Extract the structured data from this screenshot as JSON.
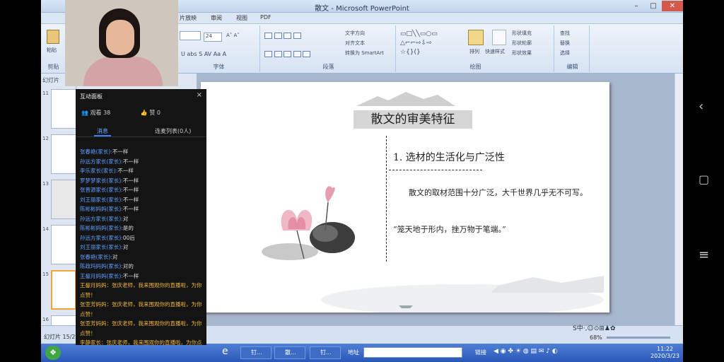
{
  "window": {
    "title": "散文 - Microsoft PowerPoint",
    "minimize": "–",
    "maximize": "□",
    "close": "✕"
  },
  "tabs": [
    "片放映",
    "审阅",
    "视图",
    "PDF"
  ],
  "ribbon": {
    "font": {
      "size": "24",
      "label": "字体"
    },
    "paragraph": {
      "text_direction": "文字方向",
      "align_text": "对齐文本",
      "smartart": "转换为 SmartArt",
      "label": "段落"
    },
    "drawing": {
      "arrange": "排列",
      "quick_styles": "快速样式",
      "fill": "形状填充",
      "outline": "形状轮廓",
      "effects": "形状效果",
      "label": "绘图"
    },
    "editing": {
      "find": "查找",
      "replace": "替换",
      "select": "选择",
      "label": "编辑"
    },
    "clipboard": {
      "paste": "粘贴",
      "label": "剪贴"
    },
    "slides_tab": "幻灯片"
  },
  "thumbnails": [
    "11",
    "12",
    "13",
    "14",
    "15",
    "16"
  ],
  "panel": {
    "title": "互动面板",
    "close": "×",
    "viewers_label": "观看",
    "viewers": "38",
    "likes_label": "赞",
    "likes": "0",
    "tab_messages": "消息",
    "tab_mic": "连麦列表(0人)",
    "messages": [
      {
        "name": "张春艳(家长):",
        "text": "不一样"
      },
      {
        "name": "孙远方家长(家长):",
        "text": "不一样"
      },
      {
        "name": "李乐家长(家长):",
        "text": "不一样"
      },
      {
        "name": "罗梦梦家长(家长):",
        "text": "不一样"
      },
      {
        "name": "张晋源家长(家长):",
        "text": "不一样"
      },
      {
        "name": "刘王丽家长(家长):",
        "text": "不一样"
      },
      {
        "name": "陈彬彬妈妈(家长):",
        "text": "不一样"
      },
      {
        "name": "孙远方家长(家长):",
        "text": "对"
      },
      {
        "name": "陈彬彬妈妈(家长):",
        "text": "是的"
      },
      {
        "name": "孙远方家长(家长):",
        "text": "00后"
      },
      {
        "name": "刘王丽家长(家长):",
        "text": "对"
      },
      {
        "name": "张春艳(家长):",
        "text": "对"
      },
      {
        "name": "陈政玛妈妈(家长):",
        "text": "对的"
      },
      {
        "name": "王鋆月妈妈(家长):",
        "text": "不一样"
      }
    ],
    "gifts": [
      "王鋆月妈妈：张庆老师，我来围观你的直播啦，为你点赞！",
      "张亚芳妈妈：张庆老师，我来围观你的直播啦，为你点赞！",
      "张亚芳妈妈：张庆老师，我来围观你的直播啦，为你点赞！",
      "李静家长：张庆老师，我来围观你的直播啦，为你点赞！"
    ]
  },
  "slide": {
    "title": "散文的审美特征",
    "subtitle": "1. 选材的生活化与广泛性",
    "para1": "散文的取材范围十分广泛，大千世界几乎无不可写。",
    "para2": "“笼天地于形内，挫万物于笔端。”"
  },
  "statusbar": {
    "slide_info": "幻灯片 15/2",
    "zoom": "68%"
  },
  "taskbar": {
    "items": [
      "钉...",
      "散...",
      "钉..."
    ],
    "address_label": "地址",
    "links": "链接",
    "time": "11:22",
    "date": "2020/3/23"
  },
  "colors": {
    "ribbon": "#dbe6f4",
    "panel": "#141414",
    "name": "#5f9fff",
    "gift": "#f0b63c",
    "taskbar": "#2a58b8"
  }
}
